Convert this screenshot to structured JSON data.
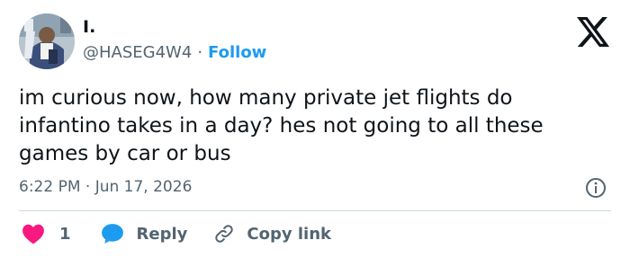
{
  "author": {
    "display_name": "I.",
    "handle": "@HASEG4W4",
    "separator": "·",
    "follow_label": "Follow"
  },
  "tweet": {
    "text": "im curious now, how many private jet flights do\ninfantino takes in a day? hes not going to all these\ngames by car or bus",
    "timestamp": "6:22 PM · Jun 17, 2026"
  },
  "actions": {
    "like_count": "1",
    "reply_label": "Reply",
    "copy_link_label": "Copy link"
  },
  "icons": {
    "brand": "x-logo-icon",
    "info": "info-icon",
    "like": "heart-icon",
    "reply": "reply-bubble-icon",
    "copy": "link-icon"
  },
  "colors": {
    "accent": "#1d9bf0",
    "heart": "#f91880",
    "text": "#0f1419",
    "muted": "#536471",
    "divider": "#cfd9de"
  }
}
